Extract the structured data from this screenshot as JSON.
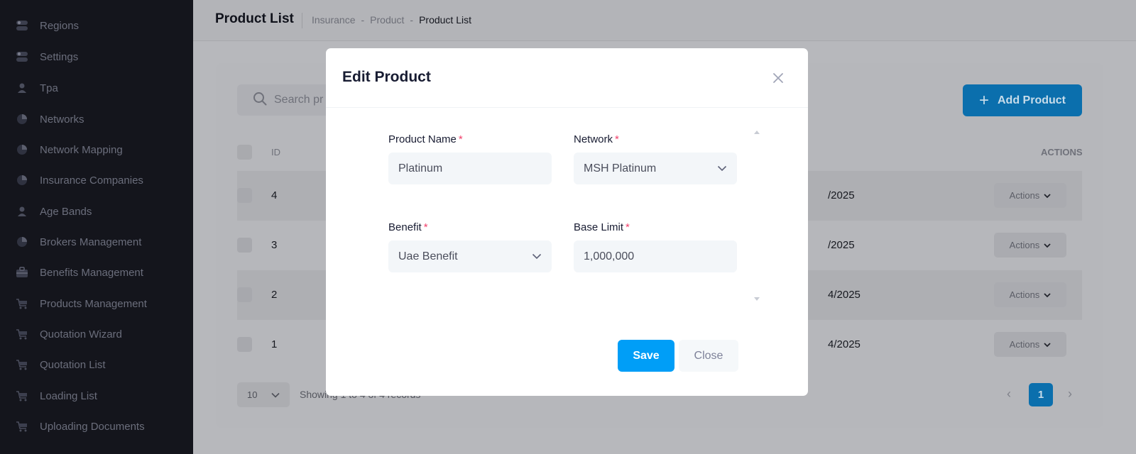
{
  "sidebar": {
    "items": [
      {
        "label": "Regions",
        "icon": "toggle-icon"
      },
      {
        "label": "Settings",
        "icon": "toggle-icon"
      },
      {
        "label": "Tpa",
        "icon": "user-icon"
      },
      {
        "label": "Networks",
        "icon": "pie-chart-icon"
      },
      {
        "label": "Network Mapping",
        "icon": "pie-chart-icon"
      },
      {
        "label": "Insurance Companies",
        "icon": "pie-chart-icon"
      },
      {
        "label": "Age Bands",
        "icon": "user-icon"
      },
      {
        "label": "Brokers Management",
        "icon": "pie-chart-icon"
      },
      {
        "label": "Benefits Management",
        "icon": "briefcase-icon"
      },
      {
        "label": "Products Management",
        "icon": "cart-icon"
      },
      {
        "label": "Quotation Wizard",
        "icon": "cart-icon"
      },
      {
        "label": "Quotation List",
        "icon": "cart-icon"
      },
      {
        "label": "Loading List",
        "icon": "cart-icon"
      },
      {
        "label": "Uploading Documents",
        "icon": "cart-icon"
      }
    ]
  },
  "header": {
    "title": "Product List",
    "breadcrumb": [
      "Insurance",
      "-",
      "Product",
      "-",
      "Product List"
    ]
  },
  "list": {
    "search_placeholder": "Search pr",
    "add_button": "Add Product",
    "columns": {
      "id": "ID",
      "actions": "ACTIONS"
    },
    "rows": [
      {
        "id": "4",
        "date": "/2025",
        "actions": "Actions"
      },
      {
        "id": "3",
        "date": "/2025",
        "actions": "Actions"
      },
      {
        "id": "2",
        "date": "4/2025",
        "actions": "Actions"
      },
      {
        "id": "1",
        "date": "4/2025",
        "actions": "Actions"
      }
    ],
    "page_size": "10",
    "showing": "Showing 1 to 4 of 4 records",
    "current_page": "1"
  },
  "modal": {
    "title": "Edit Product",
    "fields": {
      "product_name": {
        "label": "Product Name",
        "value": "Platinum"
      },
      "network": {
        "label": "Network",
        "value": "MSH Platinum"
      },
      "benefit": {
        "label": "Benefit",
        "value": "Uae Benefit"
      },
      "base_limit": {
        "label": "Base Limit",
        "value": "1,000,000"
      }
    },
    "required_mark": "*",
    "save_button": "Save",
    "close_button": "Close"
  },
  "colors": {
    "primary": "#009ef7",
    "required": "#f1416c",
    "sidebar_bg": "#14151c"
  }
}
